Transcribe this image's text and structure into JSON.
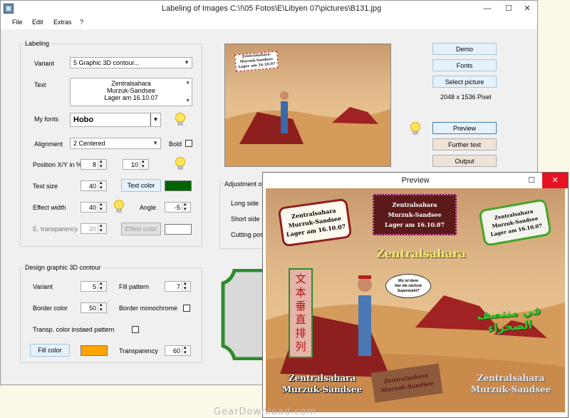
{
  "main_window": {
    "title": "Labeling of Images     C:\\!\\05 Fotos\\E\\Libyen 07\\pictures\\B131.jpg",
    "menu": [
      "File",
      "Edit",
      "Extras",
      "?"
    ]
  },
  "labeling": {
    "group_label": "Labeling",
    "variant_label": "Variant",
    "variant_value": "5 Graphic 3D contour...",
    "text_label": "Text",
    "text_lines": [
      "Zentralsahara",
      "Murzuk-Sandsee",
      "Lager am 16.10.07"
    ],
    "myfonts_label": "My fonts",
    "font_value": "Hobo",
    "alignment_label": "Alignment",
    "alignment_value": "2 Centered",
    "bold_label": "Bold",
    "position_label": "Position X/Y in %",
    "pos_x": "8",
    "pos_y": "10",
    "textsize_label": "Text size",
    "textsize_value": "40",
    "textcolor_button": "Text color",
    "effectwidth_label": "Effect width",
    "effectwidth_value": "40",
    "angle_label": "Angle",
    "angle_value": "-5",
    "transparency_label": "E. transparency",
    "transparency_value": "20",
    "effectcolor_button": "Effect color"
  },
  "design": {
    "group_label": "Design graphic 3D contour",
    "variant_label": "Variant",
    "variant_value": "5",
    "fillpattern_label": "Fill pattern",
    "fillpattern_value": "7",
    "bordercolor_label": "Border color",
    "bordercolor_value": "50",
    "bordermono_label": "Border monochrome",
    "transp_label": "Transp. color instaed pattern",
    "fillcolor_button": "Fill color",
    "transparency_label": "Transparency",
    "transparency_value": "60"
  },
  "right_panel": {
    "buttons": [
      "Demo",
      "Fonts",
      "Select picture"
    ],
    "pixel_info": "2048 x 1536 Pixel",
    "buttons2": [
      "Preview",
      "Further text",
      "Output"
    ]
  },
  "adjustment": {
    "label_prefix": "Adjustment of a",
    "long_side": "Long side",
    "short_side": "Short side",
    "cutting": "Cutting posi"
  },
  "thumbnail_label": [
    "Zentralsahara",
    "Murzuk-Sandsee",
    "Lager am 16.10.07"
  ],
  "preview_window": {
    "title": "Preview",
    "plaque1": [
      "Zentralsahara",
      "Murzuk-Sandsee",
      "Lager am 16.10.07"
    ],
    "plaque2": [
      "Zentralsahara",
      "Murzuk-Sandsee",
      "Lager am 16.10.07"
    ],
    "plaque3": [
      "Zentralsahara",
      "Murzuk-Sandsee",
      "Lager am 16.10.07"
    ],
    "headline": "Zentralsahara",
    "vertical_cjk": [
      "文",
      "本",
      "垂",
      "直",
      "排",
      "列"
    ],
    "speech_bubble": [
      "Wo ist denn",
      "hier die nächste",
      "Supermarkt?"
    ],
    "arabic": "في منتصف الصحراء",
    "bottom_left": [
      "Zentralsahara",
      "Murzuk-Sandsee"
    ],
    "bottom_mid": [
      "Zentralsahara",
      "Murzuk-Sandsee"
    ],
    "bottom_right": [
      "Zentralsahara",
      "Murzuk-Sandsee"
    ]
  },
  "watermark": "GearDownload.com",
  "colors": {
    "text_color": "#006400",
    "fill_color": "#ffa500",
    "effect_color": "#ffffff",
    "close_red": "#e81123"
  }
}
